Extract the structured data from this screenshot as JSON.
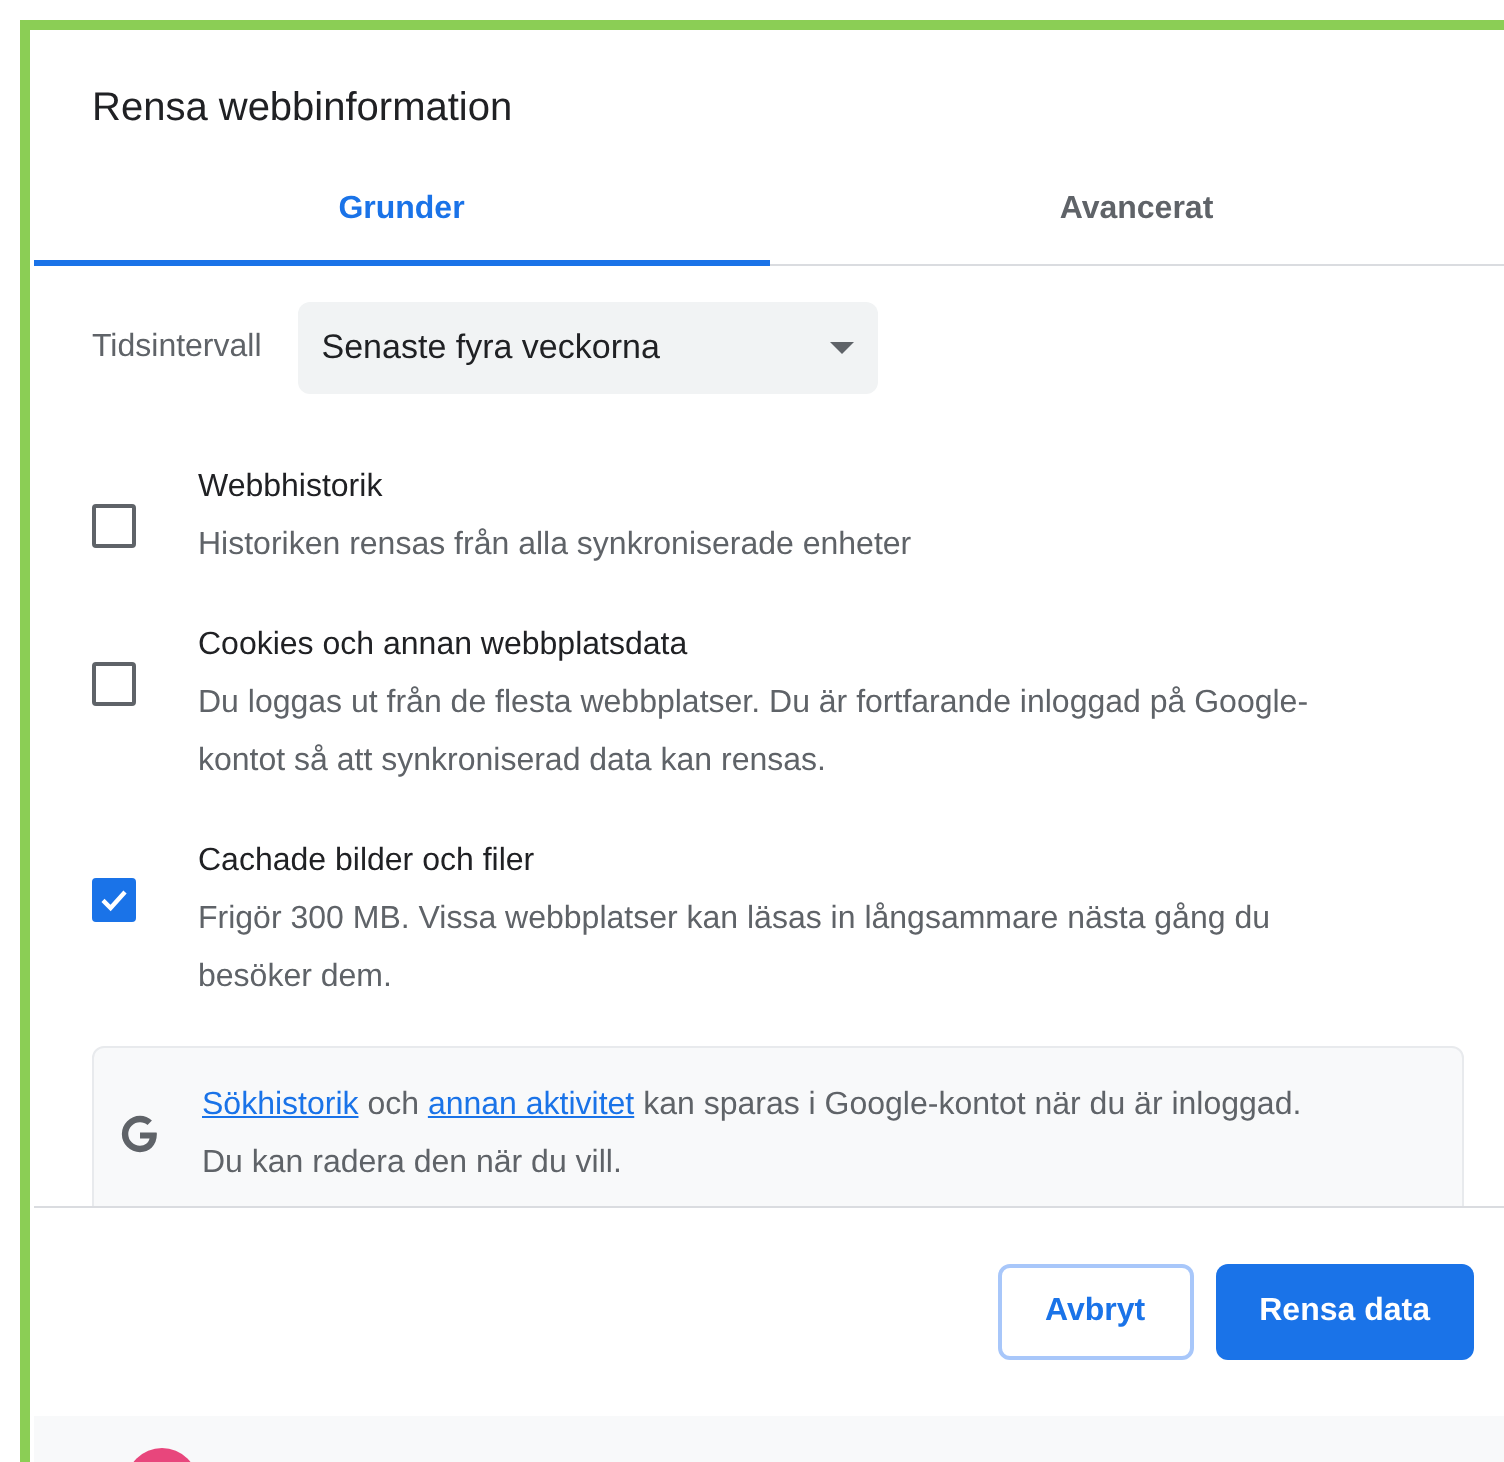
{
  "dialog": {
    "title": "Rensa webbinformation"
  },
  "tabs": [
    {
      "label": "Grunder",
      "selected": true
    },
    {
      "label": "Avancerat",
      "selected": false
    }
  ],
  "time_range": {
    "label": "Tidsintervall",
    "value": "Senaste fyra veckorna"
  },
  "options": [
    {
      "title": "Webbhistorik",
      "description": "Historiken rensas från alla synkroniserade enheter",
      "checked": false
    },
    {
      "title": "Cookies och annan webbplatsdata",
      "description": "Du loggas ut från de flesta webbplatser. Du är fortfarande inloggad på Google-kontot så att synkroniserad data kan rensas.",
      "checked": false
    },
    {
      "title": "Cachade bilder och filer",
      "description": "Frigör 300 MB. Vissa webbplatser kan läsas in långsammare nästa gång du besöker dem.",
      "checked": true
    }
  ],
  "info": {
    "segments": [
      {
        "kind": "link",
        "text": "Sökhistorik"
      },
      {
        "kind": "text",
        "text": " och "
      },
      {
        "kind": "link",
        "text": "annan aktivitet"
      },
      {
        "kind": "text",
        "text": " kan sparas i Google-kontot när du är inloggad. Du kan radera den när du vill."
      }
    ]
  },
  "buttons": [
    {
      "label": "Avbryt",
      "kind": "secondary"
    },
    {
      "label": "Rensa data",
      "kind": "primary"
    }
  ]
}
